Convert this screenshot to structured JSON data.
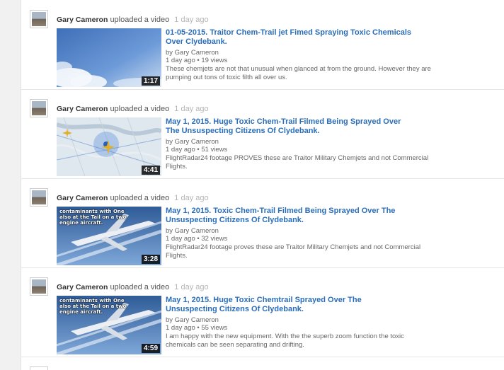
{
  "feed": {
    "items": [
      {
        "uploader": "Gary Cameron",
        "action": "uploaded a video",
        "time": "1 day ago",
        "duration": "1:17",
        "title": "01-05-2015. Traitor Chem-Trail jet Fimed Spraying Toxic Chemicals Over Clydebank.",
        "byline": "by Gary Cameron",
        "meta": "1 day ago • 19 views",
        "description": "These chemjets are not that unusual when glanced at from the ground. However they are pumping out tons of toxic filth all over us."
      },
      {
        "uploader": "Gary Cameron",
        "action": "uploaded a video",
        "time": "1 day ago",
        "duration": "4:41",
        "title": "May 1, 2015. Huge Toxic Chem-Trail Filmed Being Sprayed Over The Unsuspecting Citizens Of Clydebank.",
        "byline": "by Gary Cameron",
        "meta": "1 day ago • 51 views",
        "description": "FlightRadar24 footage PROVES these are Traitor Military Chemjets and not Commercial Flights."
      },
      {
        "uploader": "Gary Cameron",
        "action": "uploaded a video",
        "time": "1 day ago",
        "duration": "3:28",
        "title": "May 1, 2015. Toxic Chem-Trail Filmed Being Sprayed Over The Unsuspecting Citizens Of Clydebank.",
        "byline": "by Gary Cameron",
        "meta": "1 day ago • 32 views",
        "description": "FlightRadar24 footage proves these are Traitor Military Chemjets and not Commercial Flights.",
        "thumb_caption": "contaminants with One also at the Tail on a two engine aircraft."
      },
      {
        "uploader": "Gary Cameron",
        "action": "uploaded a video",
        "time": "1 day ago",
        "duration": "4:59",
        "title": "May 1, 2015. Huge Toxic Chemtrail Sprayed Over The Unsuspecting Citizens Of Clydebank.",
        "byline": "by Gary Cameron",
        "meta": "1 day ago • 55 views",
        "description": "I am happy with the new equipment. With the the superb zoom function the toxic chemicals can be seen separating and drifting.",
        "thumb_caption": "contaminants with One also at the Tail on a two engine aircraft."
      }
    ]
  },
  "colors": {
    "link": "#2a6ebb",
    "meta": "#666666",
    "timestamp": "#b5b5b5",
    "duration_bg": "#000000"
  }
}
